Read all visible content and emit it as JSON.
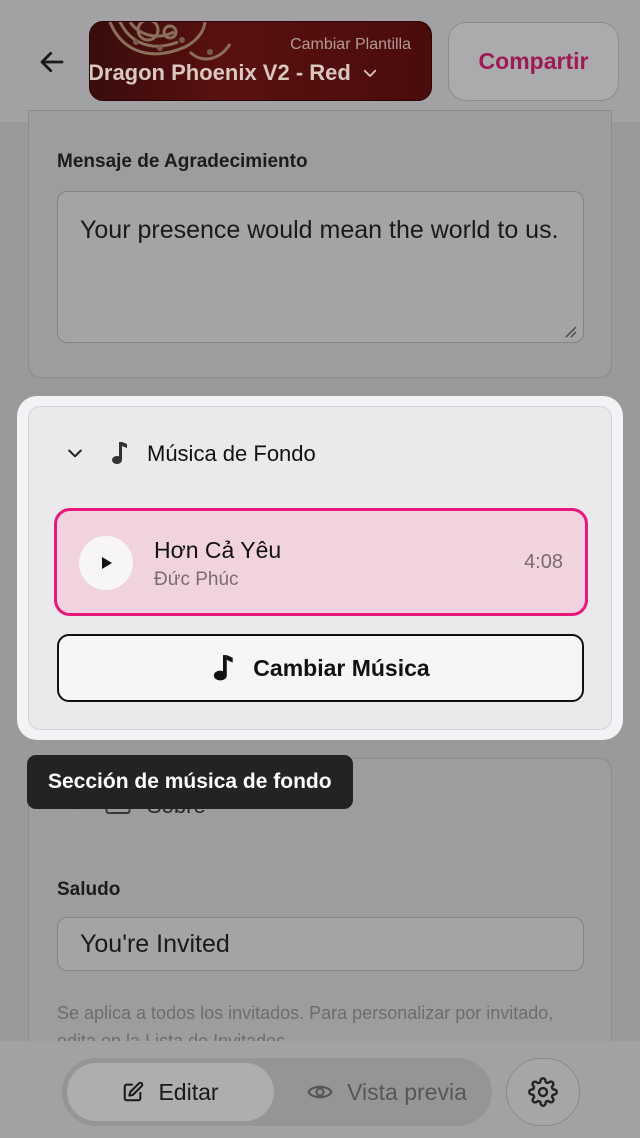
{
  "header": {
    "template_hint": "Cambiar Plantilla",
    "template_name": "Dragon Phoenix V2 - Red",
    "share_label": "Compartir"
  },
  "thanks_section": {
    "label": "Mensaje de Agradecimiento",
    "value": "Your presence would mean the world to us."
  },
  "music_section": {
    "title": "Música de Fondo",
    "track": {
      "title": "Hơn Cả Yêu",
      "artist": "Đức Phúc",
      "duration": "4:08"
    },
    "change_label": "Cambiar Música"
  },
  "tooltip": "Sección de música de fondo",
  "envelope_section": {
    "title": "Sobre",
    "greeting_label": "Saludo",
    "greeting_value": "You're Invited",
    "helper_text": "Se aplica a todos los invitados. Para personalizar por invitado, edita en la Lista de Invitados."
  },
  "bottom_nav": {
    "edit_label": "Editar",
    "preview_label": "Vista previa"
  },
  "colors": {
    "accent": "#e6197a",
    "share_text": "#9c1a55",
    "track_bg": "#f0d3de"
  }
}
